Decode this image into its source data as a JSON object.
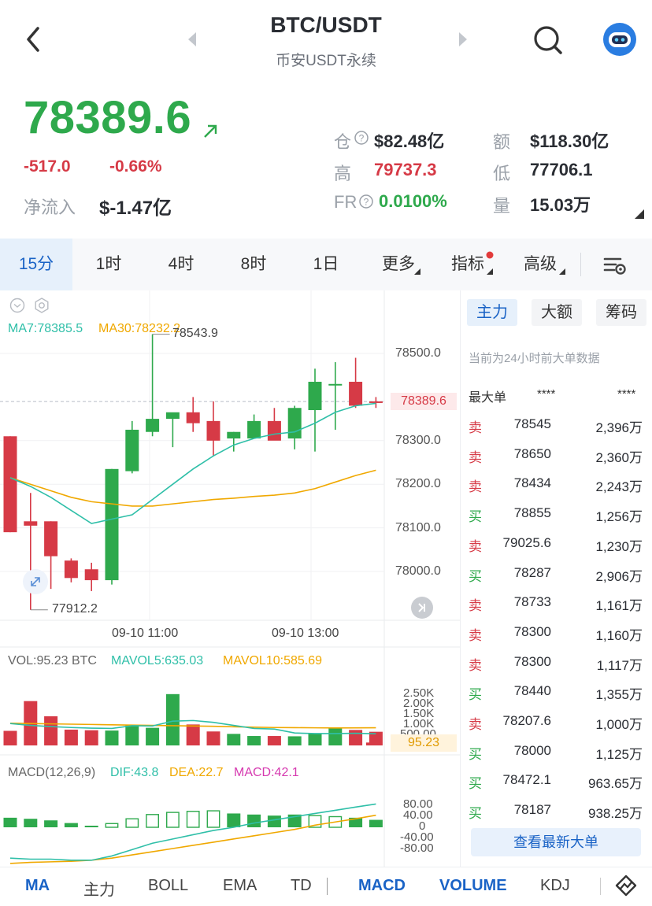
{
  "header": {
    "title": "BTC/USDT",
    "subtitle": "币安USDT永续"
  },
  "price": {
    "last": "78389.6",
    "change": "-517.0",
    "change_pct": "-0.66%",
    "net_inflow_label": "净流入",
    "net_inflow_value": "$-1.47亿"
  },
  "stats": {
    "oi_label": "仓",
    "oi_value": "$82.48亿",
    "turnover_label": "额",
    "turnover_value": "$118.30亿",
    "high_label": "高",
    "high_value": "79737.3",
    "low_label": "低",
    "low_value": "77706.1",
    "fr_label": "FR",
    "fr_value": "0.0100%",
    "volume_label": "量",
    "volume_value": "15.03万"
  },
  "tabs": {
    "items": [
      "15分",
      "1时",
      "4时",
      "8时",
      "1日",
      "更多",
      "指标",
      "高级"
    ],
    "active": "15分"
  },
  "main_chart": {
    "ma7_label": "MA7:78385.5",
    "ma30_label": "MA30:78232.2",
    "high_marker": "78543.9",
    "low_marker": "77912.2",
    "price_tag": "78389.6",
    "y_ticks": [
      "78500.0",
      "78300.0",
      "78200.0",
      "78100.0",
      "78000.0"
    ],
    "x_ticks": [
      "09-10 11:00",
      "09-10 13:00"
    ]
  },
  "volume_chart": {
    "vol_label": "VOL:95.23 BTC",
    "mavol5_label": "MAVOL5:635.03",
    "mavol10_label": "MAVOL10:585.69",
    "y_ticks": [
      "2.50K",
      "2.00K",
      "1.50K",
      "1.00K",
      "500.00"
    ],
    "current_tag": "95.23"
  },
  "macd_chart": {
    "label": "MACD(12,26,9)",
    "dif_label": "DIF:43.8",
    "dea_label": "DEA:22.7",
    "macd_label": "MACD:42.1",
    "y_ticks": [
      "80.00",
      "40.00",
      "0",
      "-40.00",
      "-80.00"
    ]
  },
  "chart_data": [
    {
      "type": "candlestick",
      "name": "price",
      "ylim": [
        77900,
        78560
      ],
      "candles": [
        {
          "o": 78310,
          "h": 78310,
          "l": 78090,
          "c": 78090
        },
        {
          "o": 78115,
          "h": 78180,
          "l": 77912,
          "c": 78105
        },
        {
          "o": 78115,
          "h": 78115,
          "l": 77960,
          "c": 78035
        },
        {
          "o": 78025,
          "h": 78030,
          "l": 77975,
          "c": 77985
        },
        {
          "o": 78005,
          "h": 78020,
          "l": 77955,
          "c": 77980
        },
        {
          "o": 77980,
          "h": 78235,
          "l": 77970,
          "c": 78235
        },
        {
          "o": 78230,
          "h": 78345,
          "l": 78225,
          "c": 78325
        },
        {
          "o": 78320,
          "h": 78544,
          "l": 78310,
          "c": 78350
        },
        {
          "o": 78350,
          "h": 78360,
          "l": 78285,
          "c": 78365
        },
        {
          "o": 78365,
          "h": 78400,
          "l": 78320,
          "c": 78340
        },
        {
          "o": 78345,
          "h": 78390,
          "l": 78265,
          "c": 78300
        },
        {
          "o": 78305,
          "h": 78320,
          "l": 78275,
          "c": 78320
        },
        {
          "o": 78305,
          "h": 78360,
          "l": 78305,
          "c": 78345
        },
        {
          "o": 78345,
          "h": 78375,
          "l": 78305,
          "c": 78300
        },
        {
          "o": 78305,
          "h": 78380,
          "l": 78280,
          "c": 78375
        },
        {
          "o": 78370,
          "h": 78465,
          "l": 78275,
          "c": 78435
        },
        {
          "o": 78430,
          "h": 78480,
          "l": 78325,
          "c": 78430
        },
        {
          "o": 78435,
          "h": 78490,
          "l": 78375,
          "c": 78380
        },
        {
          "o": 78390,
          "h": 78400,
          "l": 78375,
          "c": 78389.6
        }
      ],
      "ma7": [
        78215,
        78195,
        78170,
        78140,
        78110,
        78120,
        78130,
        78165,
        78200,
        78235,
        78265,
        78290,
        78305,
        78315,
        78320,
        78340,
        78365,
        78380,
        78385.5
      ],
      "ma30": [
        78215,
        78200,
        78185,
        78170,
        78160,
        78155,
        78150,
        78150,
        78155,
        78160,
        78165,
        78168,
        78172,
        78175,
        78180,
        78190,
        78205,
        78220,
        78232.2
      ]
    },
    {
      "type": "bar",
      "name": "volume",
      "ylim": [
        0,
        2800
      ],
      "values": [
        480,
        1460,
        960,
        520,
        500,
        490,
        660,
        580,
        1690,
        690,
        460,
        380,
        310,
        310,
        300,
        400,
        580,
        510,
        450,
        95.23
      ],
      "mavol5": [
        720,
        660,
        620,
        590,
        570,
        560,
        650,
        640,
        800,
        820,
        760,
        660,
        560,
        540,
        410,
        390,
        390,
        400,
        385,
        635.03
      ],
      "mavol10": [
        730,
        720,
        710,
        700,
        690,
        680,
        670,
        660,
        650,
        640,
        630,
        615,
        600,
        590,
        585,
        580,
        575,
        578,
        582,
        585.69
      ]
    },
    {
      "type": "bar",
      "name": "macd",
      "ylim": [
        -90,
        90
      ],
      "hist": [
        18,
        16,
        13,
        8,
        3,
        7,
        16,
        24,
        28,
        30,
        31,
        26,
        24,
        22,
        24,
        22,
        20,
        18,
        14
      ],
      "hist_hollow": [
        false,
        false,
        false,
        false,
        false,
        true,
        true,
        true,
        true,
        true,
        true,
        false,
        false,
        false,
        false,
        true,
        true,
        false,
        false
      ],
      "dif": [
        -58,
        -60,
        -60,
        -62,
        -62,
        -54,
        -42,
        -30,
        -22,
        -14,
        -6,
        0,
        8,
        14,
        20,
        26,
        32,
        38,
        43.8
      ],
      "dea": [
        -68,
        -66,
        -65,
        -64,
        -62,
        -58,
        -52,
        -46,
        -40,
        -34,
        -28,
        -22,
        -16,
        -10,
        -4,
        4,
        10,
        16,
        22.7
      ]
    }
  ],
  "right_panel": {
    "tabs": [
      "主力",
      "大额",
      "筹码"
    ],
    "notice": "当前为24小时前大单数据",
    "header_label": "最大单",
    "header_mask1": "****",
    "header_mask2": "****",
    "rows": [
      {
        "side": "卖",
        "price": "78545",
        "amount": "2,396万"
      },
      {
        "side": "卖",
        "price": "78650",
        "amount": "2,360万"
      },
      {
        "side": "卖",
        "price": "78434",
        "amount": "2,243万"
      },
      {
        "side": "买",
        "price": "78855",
        "amount": "1,256万"
      },
      {
        "side": "卖",
        "price": "79025.6",
        "amount": "1,230万"
      },
      {
        "side": "买",
        "price": "78287",
        "amount": "2,906万"
      },
      {
        "side": "卖",
        "price": "78733",
        "amount": "1,161万"
      },
      {
        "side": "卖",
        "price": "78300",
        "amount": "1,160万"
      },
      {
        "side": "卖",
        "price": "78300",
        "amount": "1,117万"
      },
      {
        "side": "买",
        "price": "78440",
        "amount": "1,355万"
      },
      {
        "side": "卖",
        "price": "78207.6",
        "amount": "1,000万"
      },
      {
        "side": "买",
        "price": "78000",
        "amount": "1,125万"
      },
      {
        "side": "买",
        "price": "78472.1",
        "amount": "963.65万"
      },
      {
        "side": "买",
        "price": "78187",
        "amount": "938.25万"
      }
    ],
    "button_label": "查看最新大单"
  },
  "bottom_bar": {
    "items": [
      "MA",
      "主力",
      "BOLL",
      "EMA",
      "TD",
      "MACD",
      "VOLUME",
      "KDJ"
    ],
    "active": [
      "MA",
      "MACD",
      "VOLUME"
    ]
  },
  "colors": {
    "up": "#2ea94c",
    "down": "#d63a46",
    "accent": "#1a63c6",
    "ma7": "#2fbfa8",
    "ma30": "#f0a800",
    "macd_label": "#d63ab0"
  }
}
